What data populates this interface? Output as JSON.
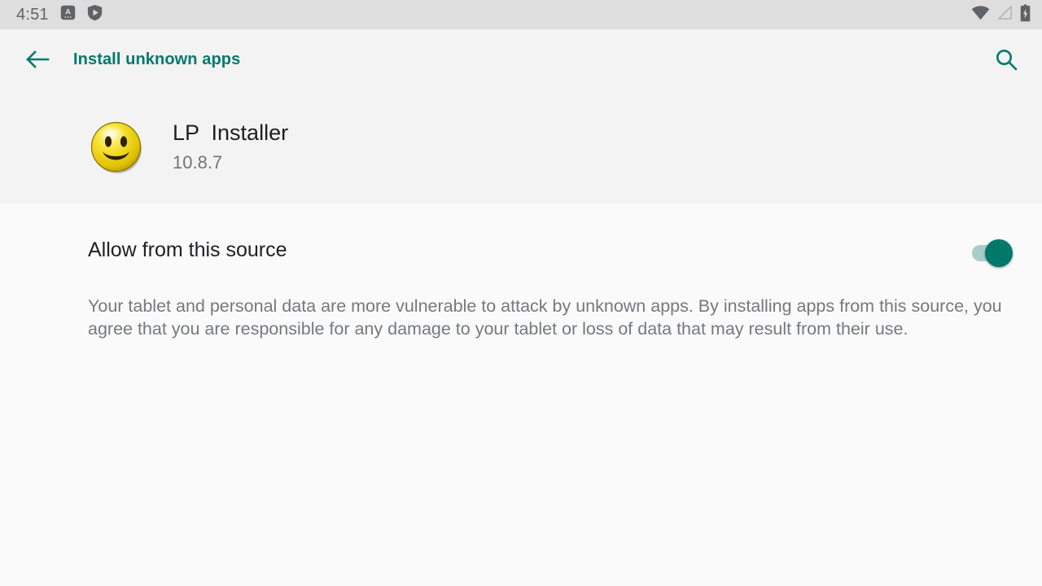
{
  "status_bar": {
    "clock": "4:51",
    "left_icons": [
      {
        "name": "translate-icon",
        "glyph": "A"
      },
      {
        "name": "play-protect-shield-icon",
        "glyph": "shield-play"
      }
    ],
    "right_icons": [
      {
        "name": "wifi-icon",
        "state": "full"
      },
      {
        "name": "mobile-signal-icon",
        "state": "no-service"
      },
      {
        "name": "battery-charging-icon",
        "state": "charging"
      }
    ],
    "background_color": "#dedede",
    "foreground_color": "#5f6368"
  },
  "app_bar": {
    "back_label": "back-arrow",
    "title": "Install unknown apps",
    "search_label": "search",
    "accent_color": "#00796b",
    "background_color": "#f3f3f3"
  },
  "app_header": {
    "icon_name": "smiley-face-app-icon",
    "app_name": "LP  Installer",
    "version": "10.8.7",
    "background_color": "#f3f3f3"
  },
  "settings": {
    "allow_source": {
      "label": "Allow from this source",
      "enabled": true,
      "track_color": "#a9cdc8",
      "thumb_color": "#00796b"
    },
    "description": "Your tablet and personal data are more vulnerable to attack by unknown apps. By installing apps from this source, you agree that you are responsible for any damage to your tablet or loss of data that may result from their use."
  }
}
